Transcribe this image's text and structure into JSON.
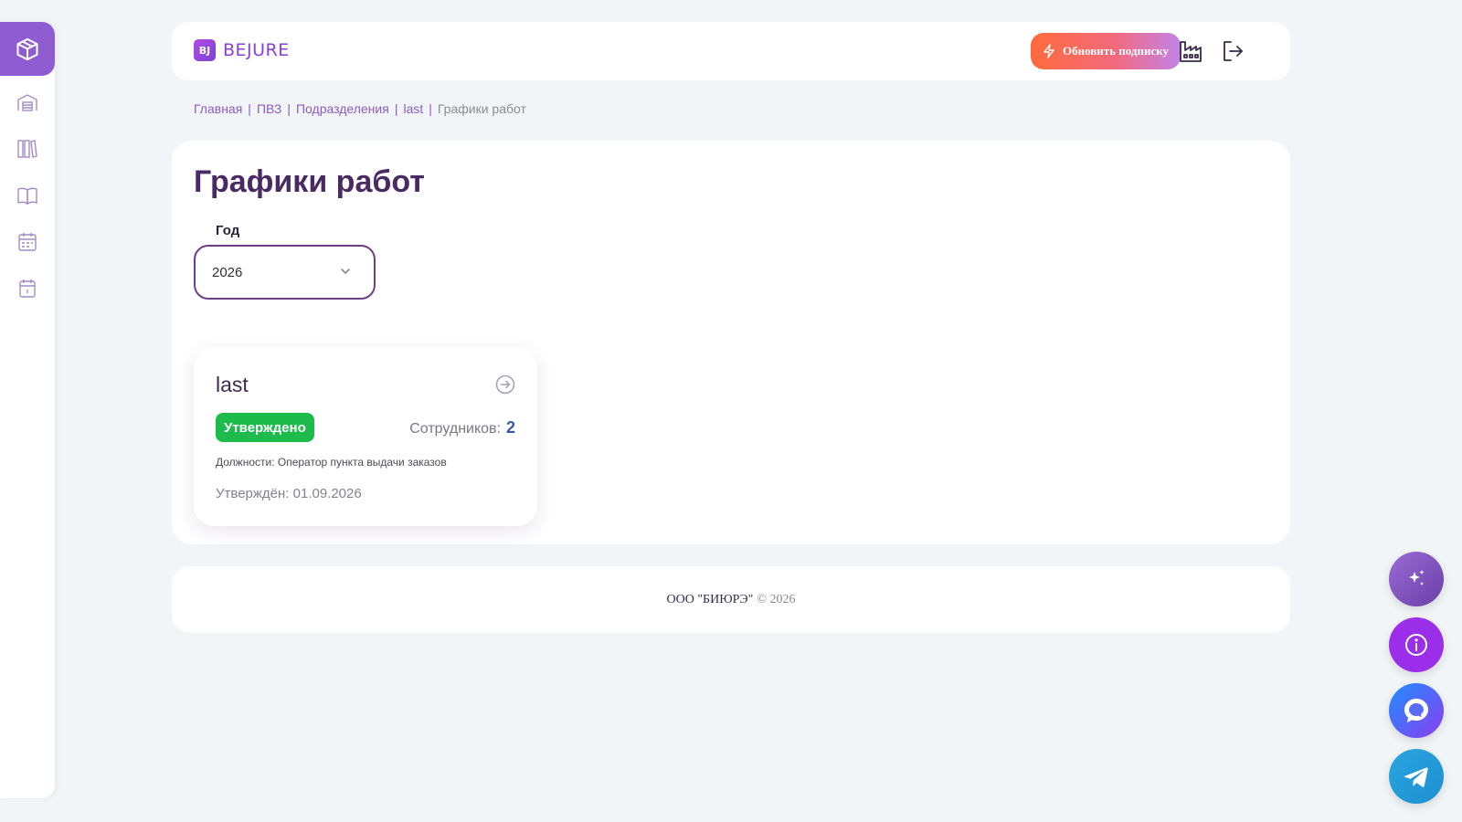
{
  "sidebar": {
    "items": [
      {
        "name": "box-icon",
        "active": true
      },
      {
        "name": "warehouse-icon"
      },
      {
        "name": "library-icon"
      },
      {
        "name": "book-icon"
      },
      {
        "name": "calendar-grid-icon"
      },
      {
        "name": "calendar-day-icon"
      }
    ]
  },
  "header": {
    "logo_mark": "BJ",
    "logo_text": "BEJURE",
    "upgrade_label": "Обновить подписку",
    "icons": [
      "factory-icon",
      "logout-icon"
    ]
  },
  "breadcrumb": {
    "items": [
      "Главная",
      "ПВЗ",
      "Подразделения",
      "last"
    ],
    "separator": "|",
    "current": "Графики работ"
  },
  "main": {
    "title": "Графики работ",
    "year_label": "Год",
    "year_value": "2026"
  },
  "card": {
    "title": "last",
    "status": "Утверждено",
    "employees_label": "Сотрудников:",
    "employees_count": "2",
    "positions": "Должности: Оператор пункта выдачи заказов",
    "approved": "Утверждён: 01.09.2026"
  },
  "footer": {
    "company": "ООО \"БИЮРЭ\"",
    "copyright": "© 2026"
  },
  "colors": {
    "accent": "#8e5bd0",
    "title": "#4a2a63",
    "status_green": "#1dbb4b",
    "count_blue": "#3b59a8"
  },
  "fabs": [
    "sparkles-icon",
    "info-icon",
    "chat-icon",
    "telegram-icon"
  ]
}
